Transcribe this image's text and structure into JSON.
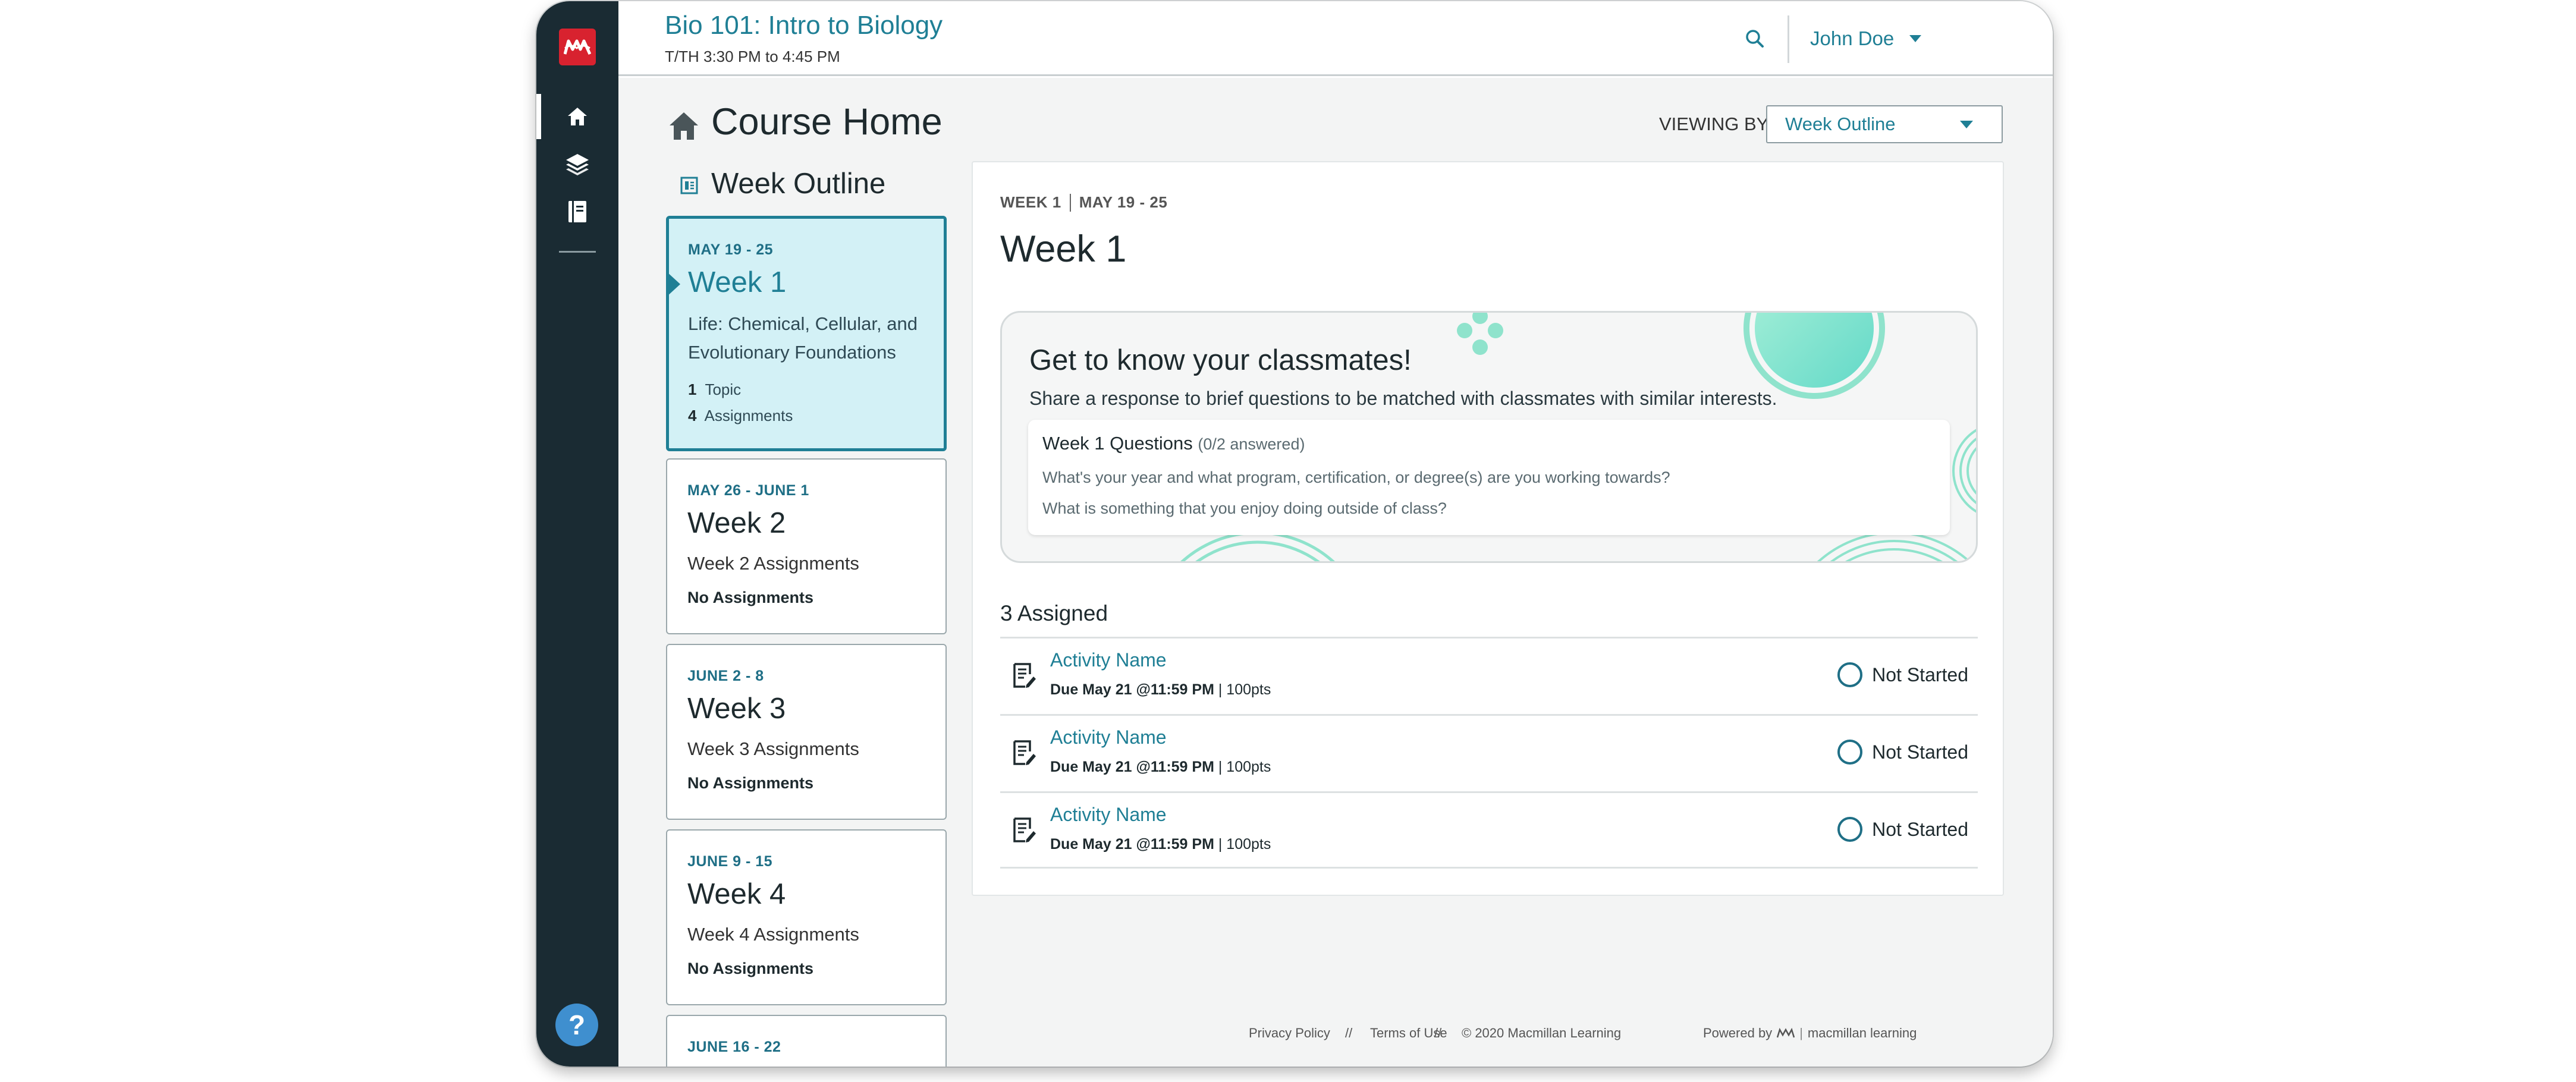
{
  "header": {
    "course_title": "Bio 101: Intro to Biology",
    "course_schedule": "T/TH 3:30 PM to 4:45 PM",
    "user_name": "John Doe"
  },
  "page": {
    "title": "Course Home",
    "viewing_label": "VIEWING BY:",
    "viewing_value": "Week Outline",
    "outline_title": "Week Outline"
  },
  "weeks": [
    {
      "date": "MAY 19 - 25",
      "title": "Week 1",
      "description": "Life: Chemical, Cellular, and Evolutionary Foundations",
      "topics_count": "1",
      "topics_label": "Topic",
      "assignments_count": "4",
      "assignments_label": "Assignments"
    },
    {
      "date": "MAY 26 - JUNE 1",
      "title": "Week 2",
      "line": "Week 2 Assignments",
      "status": "No Assignments"
    },
    {
      "date": "JUNE 2 - 8",
      "title": "Week 3",
      "line": "Week 3 Assignments",
      "status": "No Assignments"
    },
    {
      "date": "JUNE 9 - 15",
      "title": "Week 4",
      "line": "Week 4 Assignments",
      "status": "No Assignments"
    },
    {
      "date": "JUNE 16 - 22"
    }
  ],
  "detail": {
    "crumb_week": "WEEK 1",
    "crumb_dates": "MAY 19 - 25",
    "title": "Week 1",
    "promo": {
      "title": "Get to know your classmates!",
      "subtitle": "Share a response to brief questions to be matched with classmates with similar interests.",
      "questions_title": "Week 1 Questions",
      "questions_count": "(0/2 answered)",
      "questions": [
        "What's your year and what program, certification, or degree(s) are you working towards?",
        "What is something that you enjoy doing outside of class?"
      ]
    },
    "assigned_heading": "3 Assigned",
    "activities": [
      {
        "name": "Activity Name",
        "due": "Due May 21 @11:59 PM",
        "points": " | 100pts",
        "status": "Not Started"
      },
      {
        "name": "Activity Name",
        "due": "Due May 21 @11:59 PM",
        "points": " | 100pts",
        "status": "Not Started"
      },
      {
        "name": "Activity Name",
        "due": "Due May 21 @11:59 PM",
        "points": " | 100pts",
        "status": "Not Started"
      }
    ]
  },
  "footer": {
    "privacy": "Privacy Policy",
    "sep": "//",
    "terms": "Terms of Use",
    "copyright": "© 2020 Macmillan Learning",
    "powered_by": "Powered by",
    "brand": "macmillan learning"
  },
  "icons": {
    "logo": "macmillan-logo-icon",
    "nav": [
      "home-icon",
      "courses-icon",
      "ebook-icon"
    ],
    "help": "help-icon",
    "search": "search-icon"
  },
  "colors": {
    "accent": "#1f7f95",
    "rail": "#1a2b33",
    "brand_red": "#d8222f",
    "selected_bg": "#d3f1f6"
  }
}
